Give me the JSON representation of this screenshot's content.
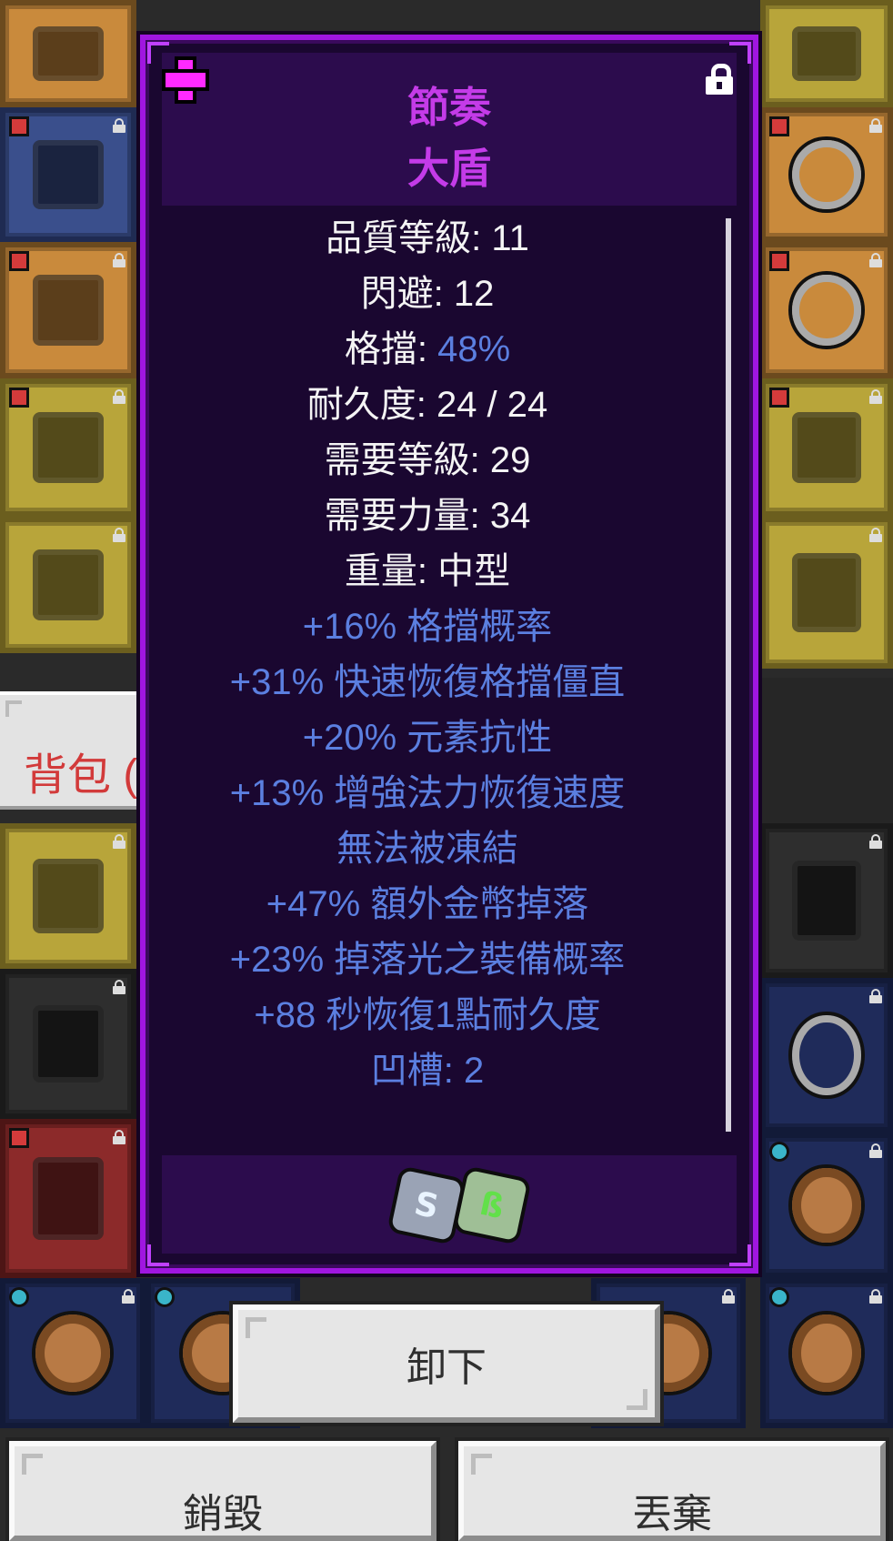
{
  "tooltip": {
    "name": "節奏",
    "type": "大盾",
    "rarity_icon": "plus-cross-icon",
    "rarity_color": "#ff2aff",
    "name_color": "#c43be8",
    "border_color": "#a016e0",
    "locked": true,
    "base_stats": [
      {
        "label": "品質等級: ",
        "value": "11"
      },
      {
        "label": "閃避: ",
        "value": "12"
      },
      {
        "label": "格擋: ",
        "value": "48%",
        "highlight": true
      },
      {
        "label": "耐久度: ",
        "value": "24 / 24"
      },
      {
        "label": "需要等級: ",
        "value": "29"
      },
      {
        "label": "需要力量: ",
        "value": "34"
      },
      {
        "label": "重量: ",
        "value": "中型"
      }
    ],
    "affixes": [
      "+16% 格擋概率",
      "+31% 快速恢復格擋僵直",
      "+20% 元素抗性",
      "+13% 增強法力恢復速度",
      "無法被凍結",
      "+47% 額外金幣掉落",
      "+23% 掉落光之裝備概率",
      "+88 秒恢復1點耐久度",
      "凹槽: 2"
    ],
    "sockets": [
      {
        "rune": "S",
        "icon": "silver-rune-icon"
      },
      {
        "rune": "ß",
        "icon": "green-rune-icon"
      }
    ],
    "affix_color": "#5b7fe0"
  },
  "bag": {
    "label": "背包 ("
  },
  "buttons": {
    "unequip": "卸下",
    "destroy": "銷毀",
    "drop": "丟棄"
  }
}
